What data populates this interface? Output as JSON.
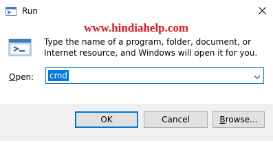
{
  "window": {
    "title": "Run",
    "close_icon": "close-icon"
  },
  "watermark": "www.hindiahelp.com",
  "description": "Type the name of a program, folder, document, or Internet resource, and Windows will open it for you.",
  "open_field": {
    "label_underlined": "O",
    "label_rest": "pen:",
    "value": "cmd"
  },
  "buttons": {
    "ok": "OK",
    "cancel": "Cancel",
    "browse_underlined": "B",
    "browse_rest": "rowse..."
  },
  "colors": {
    "accent": "#0078d7",
    "watermark": "#e8161e",
    "footer": "#f0f0f0"
  }
}
